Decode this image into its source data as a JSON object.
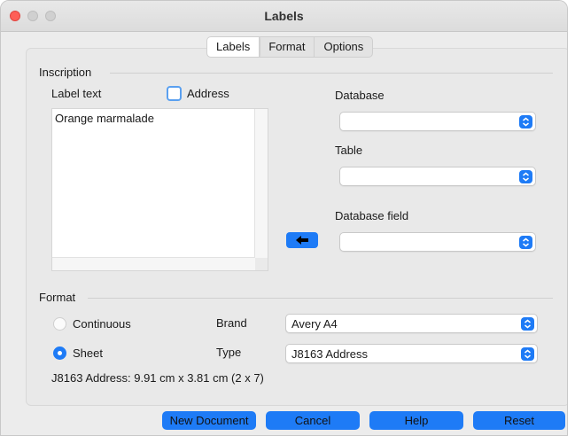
{
  "window": {
    "title": "Labels"
  },
  "tabs": [
    {
      "label": "Labels",
      "active": true
    },
    {
      "label": "Format",
      "active": false
    },
    {
      "label": "Options",
      "active": false
    }
  ],
  "inscription": {
    "section_label": "Inscription",
    "label_text_caption": "Label text",
    "address_checkbox_label": "Address",
    "address_checked": false,
    "label_text_value": "Orange marmalade",
    "database_label": "Database",
    "database_value": "",
    "table_label": "Table",
    "table_value": "",
    "database_field_label": "Database field",
    "database_field_value": "",
    "insert_arrow_icon": "left-arrow-icon"
  },
  "format": {
    "section_label": "Format",
    "continuous_label": "Continuous",
    "sheet_label": "Sheet",
    "selected": "Sheet",
    "brand_label": "Brand",
    "brand_value": "Avery A4",
    "type_label": "Type",
    "type_value": "J8163 Address",
    "summary": "J8163 Address: 9.91 cm x 3.81 cm (2 x 7)"
  },
  "buttons": {
    "new_document": "New Document",
    "cancel": "Cancel",
    "help": "Help",
    "reset": "Reset"
  },
  "colors": {
    "accent": "#1e7bf6",
    "close_light": "#fe5f57"
  }
}
